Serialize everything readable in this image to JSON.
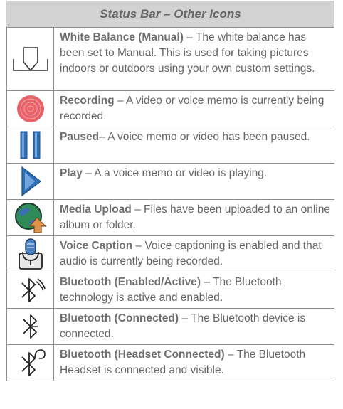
{
  "table": {
    "title": "Status Bar – Other Icons",
    "rows": [
      {
        "icon": "white-balance-manual-icon",
        "term": "White Balance (Manual)",
        "sep": " – ",
        "desc": "The white balance has been set to Manual. This is used for taking pictures indoors or outdoors using your own custom settings."
      },
      {
        "icon": "recording-icon",
        "term": "Recording",
        "sep": " – ",
        "desc": "A video or voice memo is currently being recorded."
      },
      {
        "icon": "paused-icon",
        "term": "Paused",
        "sep": "– ",
        "desc": "A voice memo or video has been paused."
      },
      {
        "icon": "play-icon",
        "term": "Play",
        "sep": " – ",
        "desc": "A a voice memo or video is playing."
      },
      {
        "icon": "media-upload-icon",
        "term": "Media Upload",
        "sep": " – ",
        "desc": "Files have been uploaded to an online album or folder."
      },
      {
        "icon": "voice-caption-icon",
        "term": "Voice Caption",
        "sep": " – ",
        "desc": "Voice captioning is enabled and that audio is currently being recorded."
      },
      {
        "icon": "bluetooth-enabled-icon",
        "term": "Bluetooth (Enabled/Active)",
        "sep": " – ",
        "desc": "The Bluetooth technology is active and enabled."
      },
      {
        "icon": "bluetooth-connected-icon",
        "term": "Bluetooth (Connected)",
        "sep": " – ",
        "desc": "The Bluetooth device is connected."
      },
      {
        "icon": "bluetooth-headset-icon",
        "term": "Bluetooth (Headset Connected)",
        "sep": " – ",
        "desc": "The Bluetooth Headset is connected and visible."
      }
    ]
  },
  "colors": {
    "recording": "#e8626a",
    "paused": "#2f6fb4",
    "play": "#2f6fb4",
    "globe": "#2e8b57",
    "upload_arrow": "#e0944a"
  }
}
